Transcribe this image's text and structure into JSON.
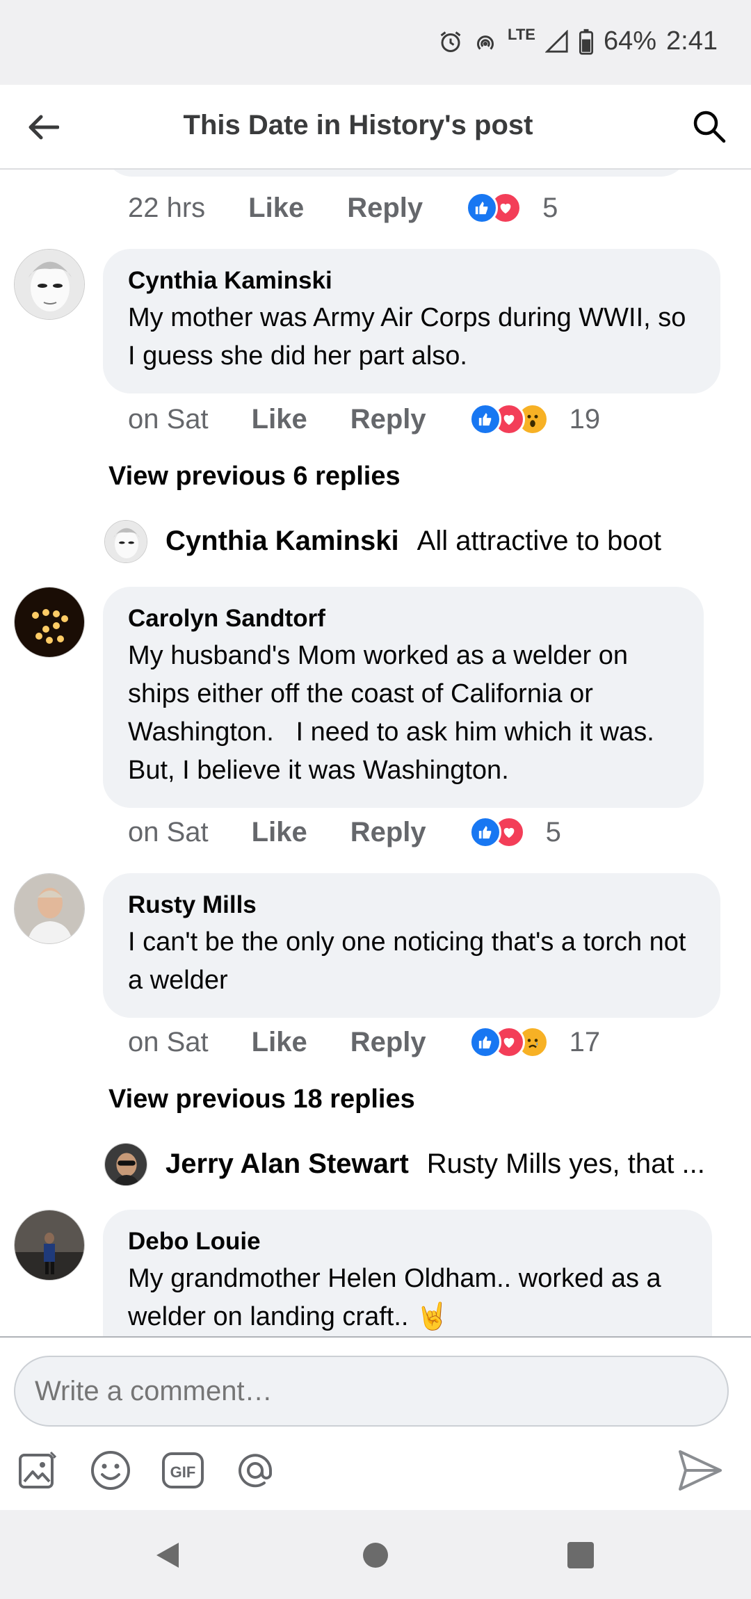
{
  "status_bar": {
    "battery": "64%",
    "time": "2:41",
    "network": "LTE"
  },
  "header": {
    "title": "This Date in History's post"
  },
  "comments": [
    {
      "time": "22 hrs",
      "like": "Like",
      "reply": "Reply",
      "count": "5"
    },
    {
      "name": "Cynthia Kaminski",
      "text": "My mother was Army Air Corps during WWII, so I guess she did her part also.",
      "time": "on Sat",
      "like": "Like",
      "reply": "Reply",
      "count": "19",
      "view_previous": "View previous 6 replies",
      "latest_reply": {
        "name": "Cynthia Kaminski",
        "text": "All attractive to boot"
      }
    },
    {
      "name": "Carolyn Sandtorf",
      "text": "My husband's Mom worked as a welder on ships either off the coast of California or Washington.   I need to ask him which it was.   But, I believe it was Washington.",
      "time": "on Sat",
      "like": "Like",
      "reply": "Reply",
      "count": "5"
    },
    {
      "name": "Rusty Mills",
      "text": "I can't be the only one noticing that's a torch not a welder",
      "time": "on Sat",
      "like": "Like",
      "reply": "Reply",
      "count": "17",
      "view_previous": "View previous 18 replies",
      "latest_reply": {
        "name": "Jerry Alan Stewart",
        "text": "Rusty Mills yes, that ..."
      }
    },
    {
      "name": "Debo Louie",
      "text": "My grandmother Helen Oldham.. worked as a welder on landing craft.. 🤘"
    }
  ],
  "composer": {
    "placeholder": "Write a comment…"
  },
  "colors": {
    "like": "#1877f2",
    "love": "#f33e58",
    "wow": "#f7b125",
    "bubble": "#f0f2f5"
  }
}
